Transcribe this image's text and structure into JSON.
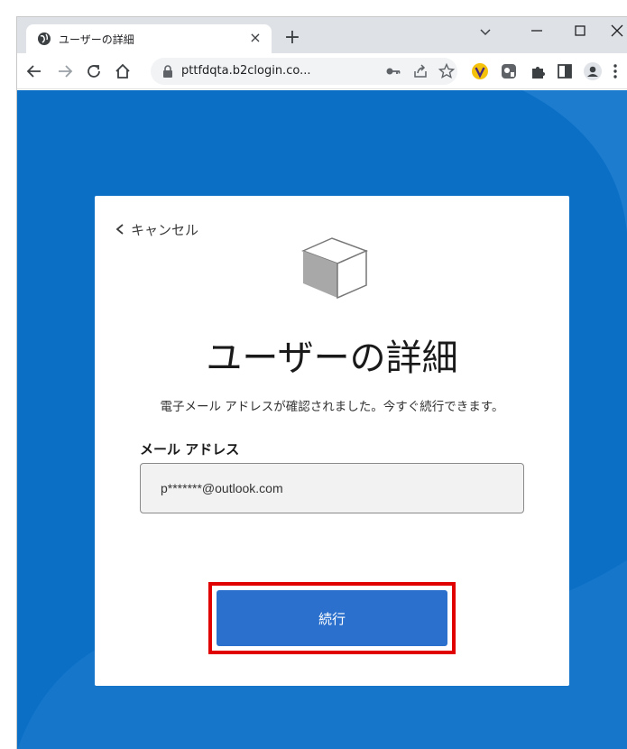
{
  "browser": {
    "tab_title": "ユーザーの詳細",
    "tab_close": "×",
    "new_tab": "+",
    "url": "pttfdqta.b2clogin.co..."
  },
  "card": {
    "cancel_label": "キャンセル",
    "title": "ユーザーの詳細",
    "message": "電子メール アドレスが確認されました。今すぐ続行できます。",
    "email_label": "メール アドレス",
    "email_value": "p*******@outlook.com",
    "continue_label": "続行"
  },
  "colors": {
    "page_background": "#0b6fc6",
    "button": "#2b70cc",
    "highlight": "#e00000"
  }
}
